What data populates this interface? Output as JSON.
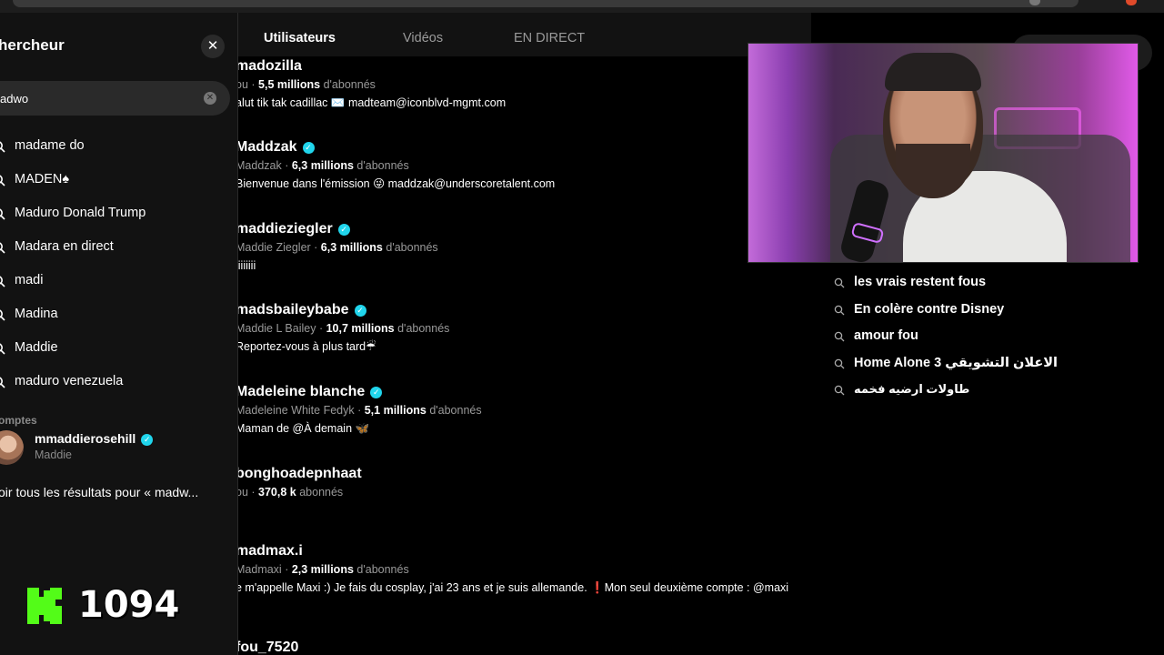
{
  "search_panel": {
    "title": "hercheur",
    "close_glyph": "✕",
    "query": "adwo",
    "suggestions": [
      {
        "label": "madame do",
        "icon": "search-icon"
      },
      {
        "label": "MADEN♠",
        "icon": "search-icon"
      },
      {
        "label": "Maduro Donald Trump",
        "icon": "search-icon"
      },
      {
        "label": "Madara en direct",
        "icon": "search-icon"
      },
      {
        "label": "madi",
        "icon": "search-icon"
      },
      {
        "label": "Madina",
        "icon": "search-icon"
      },
      {
        "label": "Maddie",
        "icon": "search-icon"
      },
      {
        "label": "maduro venezuela",
        "icon": "search-icon"
      }
    ],
    "accounts_label": "omptes",
    "account": {
      "username": "mmaddierosehill",
      "display_name": "Maddie",
      "verified": true
    },
    "see_all": "oir tous les résultats pour « madw..."
  },
  "counter": {
    "value": "1094",
    "logo_letter": "K",
    "logo_color": "#53fc18"
  },
  "tabs": [
    {
      "label": "Utilisateurs",
      "active": true
    },
    {
      "label": "Vidéos",
      "active": false
    },
    {
      "label": "EN DIRECT",
      "active": false
    }
  ],
  "results": [
    {
      "name": "madozilla",
      "verified": false,
      "display": "ou",
      "followers": "5,5 millions",
      "followers_suffix": "d'abonnés",
      "bio": "alut tik tak cadillac ✉️ madteam@iconblvd-mgmt.com"
    },
    {
      "name": "Maddzak",
      "verified": true,
      "display": "Maddzak",
      "followers": "6,3 millions",
      "followers_suffix": "d'abonnés",
      "bio": "Bienvenue dans l'émission 😜 maddzak@underscoretalent.com"
    },
    {
      "name": "maddieziegler",
      "verified": true,
      "display": "Maddie Ziegler",
      "followers": "6,3 millions",
      "followers_suffix": "d'abonnés",
      "bio": "iiiiiiii"
    },
    {
      "name": "madsbaileybabe",
      "verified": true,
      "display": "Maddie L Bailey",
      "followers": "10,7 millions",
      "followers_suffix": "d'abonnés",
      "bio": "Reportez-vous à plus tard☔"
    },
    {
      "name": "Madeleine blanche",
      "verified": true,
      "display": "Madeleine White Fedyk",
      "followers": "5,1 millions",
      "followers_suffix": "d'abonnés",
      "bio": "Maman de @À demain 🦋"
    },
    {
      "name": "bonghoadepnhaat",
      "verified": false,
      "display": "ou",
      "followers": "370,8 k",
      "followers_suffix": "abonnés",
      "bio": ""
    },
    {
      "name": "madmax.i",
      "verified": false,
      "display": "Madmaxi",
      "followers": "2,3 millions",
      "followers_suffix": "d'abonnés",
      "bio": "e m'appelle Maxi :) Je fais du cosplay, j'ai 23 ans et je suis allemande. ❗Mon seul deuxième compte : @maxi"
    },
    {
      "name": "fou_7520",
      "verified": false,
      "display": "",
      "followers": "",
      "followers_suffix": "",
      "bio": ""
    }
  ],
  "trending": [
    {
      "label": "les vrais restent fous",
      "icon": "search-icon"
    },
    {
      "label": "En colère contre Disney",
      "icon": "search-icon"
    },
    {
      "label": "amour fou",
      "icon": "search-icon"
    },
    {
      "label": "Home Alone 3 الاعلان التشويقي",
      "icon": "search-icon"
    },
    {
      "label": "طاولات ارضيه فخمه",
      "icon": "search-icon"
    }
  ],
  "colors": {
    "verified": "#20d5ec",
    "panel_bg": "#121212",
    "kick_green": "#53fc18"
  }
}
